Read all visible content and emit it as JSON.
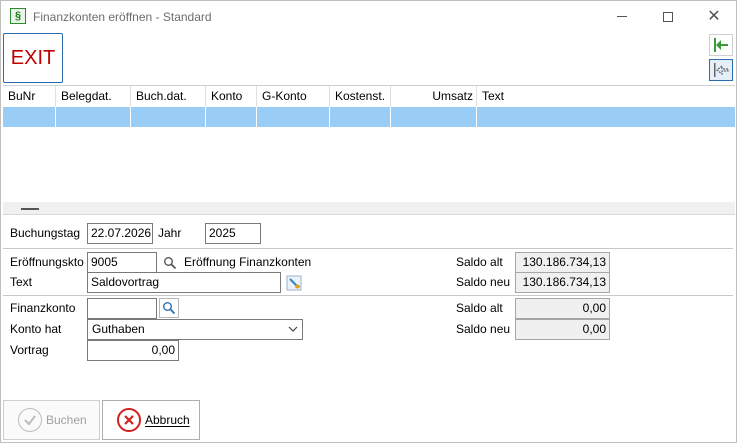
{
  "window": {
    "title": "Finanzkonten eröffnen - Standard",
    "app_icon_glyph": "§"
  },
  "toolbar": {
    "exit_label": "EXIT"
  },
  "grid": {
    "columns": [
      "BuNr",
      "Belegdat.",
      "Buch.dat.",
      "Konto",
      "G-Konto",
      "Kostenst.",
      "Umsatz",
      "Text"
    ]
  },
  "buchung": {
    "buchungstag_label": "Buchungstag",
    "buchungstag_value": "22.07.2026",
    "jahr_label": "Jahr",
    "jahr_value": "2025"
  },
  "eroeffnung": {
    "konto_label": "Eröffnungskto",
    "konto_value": "9005",
    "konto_name": "Eröffnung Finanzkonten",
    "text_label": "Text",
    "text_value": "Saldovortrag",
    "saldo_alt_label": "Saldo alt",
    "saldo_alt_value": "130.186.734,13",
    "saldo_neu_label": "Saldo neu",
    "saldo_neu_value": "130.186.734,13"
  },
  "finanzkonto": {
    "label": "Finanzkonto",
    "value": "",
    "konto_hat_label": "Konto hat",
    "konto_hat_value": "Guthaben",
    "vortrag_label": "Vortrag",
    "vortrag_value": "0,00",
    "saldo_alt_label": "Saldo alt",
    "saldo_alt_value": "0,00",
    "saldo_neu_label": "Saldo neu",
    "saldo_neu_value": "0,00"
  },
  "buttons": {
    "buchen_label": "Buchen",
    "abbruch_label": "Abbruch"
  },
  "colors": {
    "selection": "#99cdf6",
    "exit_text": "#c00000",
    "accent_border": "#2b6cb0",
    "cancel_icon": "#d42020"
  }
}
